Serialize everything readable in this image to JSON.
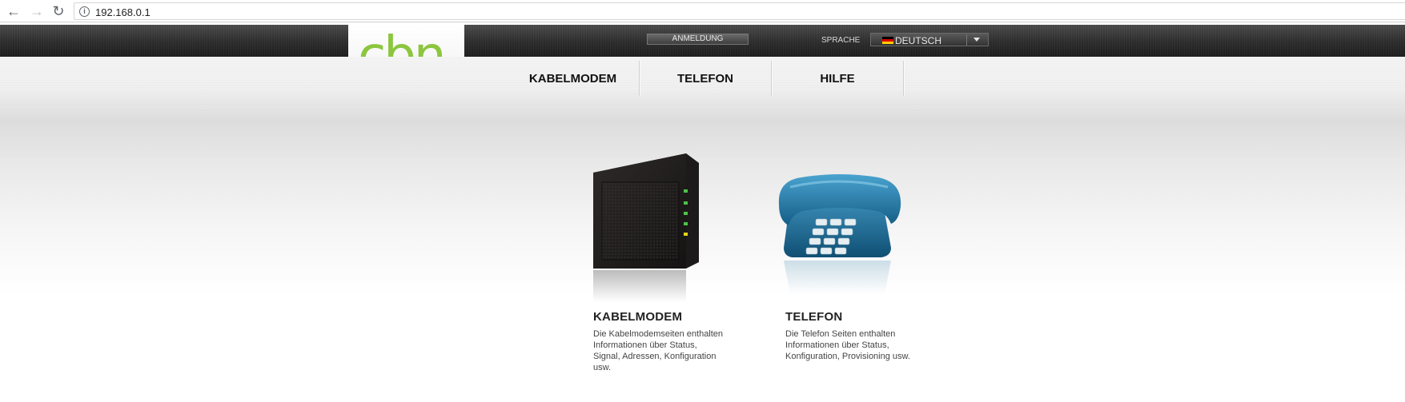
{
  "browser": {
    "url": "192.168.0.1",
    "back_icon": "arrow-left-icon",
    "forward_icon": "arrow-right-icon",
    "reload_icon": "reload-icon",
    "info_icon": "info-icon"
  },
  "header": {
    "logo_text": "cbn",
    "logo_color": "#8cc63f",
    "login_label": "ANMELDUNG",
    "language_label": "SPRACHE",
    "language_value": "DEUTSCH",
    "language_flag": "german-flag-icon"
  },
  "nav": {
    "items": [
      {
        "label": "KABELMODEM"
      },
      {
        "label": "TELEFON"
      },
      {
        "label": "HILFE"
      }
    ]
  },
  "cards": [
    {
      "title": "KABELMODEM",
      "icon": "cable-modem-icon",
      "description_lines": [
        "Die Kabelmodemseiten enthalten",
        "Informationen über Status,",
        "Signal, Adressen, Konfiguration",
        "usw."
      ]
    },
    {
      "title": "TELEFON",
      "icon": "telephone-icon",
      "description_lines": [
        "Die Telefon Seiten enthalten",
        "Informationen über Status,",
        "Konfiguration, Provisioning usw."
      ]
    }
  ]
}
